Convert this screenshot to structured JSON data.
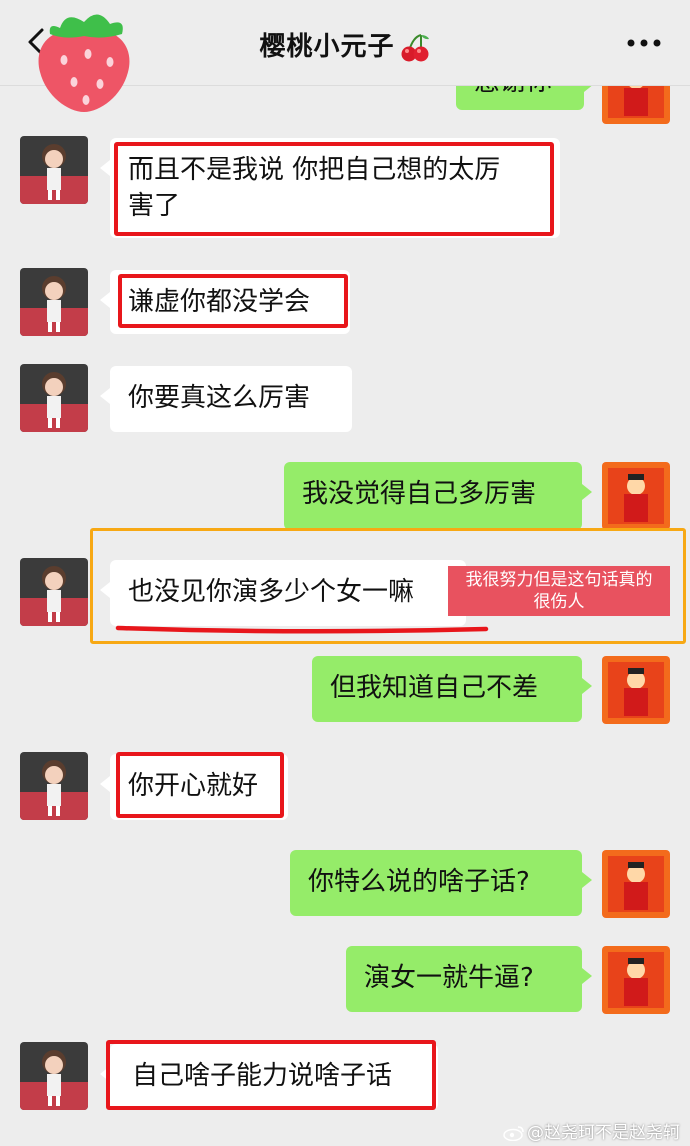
{
  "header": {
    "title": "樱桃小元子",
    "title_emoji": "cherry-icon"
  },
  "colors": {
    "outgoing_bubble": "#95ec69",
    "incoming_bubble": "#ffffff",
    "highlight_red": "#e8161b",
    "highlight_orange": "#f7a814",
    "annotation_bg": "#e8525f"
  },
  "messages": [
    {
      "from": "me",
      "text": "感谢你"
    },
    {
      "from": "them",
      "text": "而且不是我说 你把自己想的太厉害了",
      "line1": "而且不是我说 你把自己想的太厉",
      "line2": "害了"
    },
    {
      "from": "them",
      "text": "谦虚你都没学会"
    },
    {
      "from": "them",
      "text": "你要真这么厉害"
    },
    {
      "from": "me",
      "text": "我没觉得自己多厉害"
    },
    {
      "from": "them",
      "text": "也没见你演多少个女一嘛"
    },
    {
      "from": "me",
      "text": "但我知道自己不差"
    },
    {
      "from": "them",
      "text": "你开心就好"
    },
    {
      "from": "me",
      "text": "你特么说的啥子话?"
    },
    {
      "from": "me",
      "text": "演女一就牛逼?"
    },
    {
      "from": "them",
      "text": "自己啥子能力说啥子话"
    }
  ],
  "annotation": {
    "line1": "我很努力但是这句话真的",
    "line2": "很伤人"
  },
  "watermark": "@赵尧珂不是赵尧轲"
}
